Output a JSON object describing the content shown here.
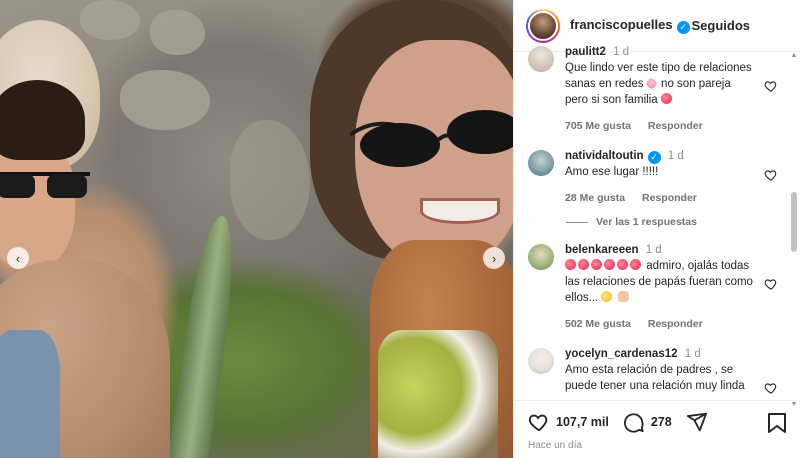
{
  "post": {
    "username": "franciscopuelles",
    "follow_state": "Seguidos"
  },
  "comments": [
    {
      "username": "paulitt2",
      "time": "1 d",
      "text": "Que lindo ver este tipo de relaciones sanas en redes",
      "text_tail": " no son pareja pero si son familia",
      "likes": "705 Me gusta",
      "reply": "Responder",
      "avatar_color": "#d9cfc6"
    },
    {
      "username": "natividaltoutin",
      "time": "1 d",
      "text": "Amo ese lugar !!!!!",
      "likes": "28 Me gusta",
      "reply": "Responder",
      "view_replies": "Ver las 1 respuestas",
      "avatar_color": "#7a9aa3"
    },
    {
      "username": "belenkareeen",
      "time": "1 d",
      "text": " admiro, ojalás todas las relaciones de papás fueran como ellos...",
      "likes": "502 Me gusta",
      "reply": "Responder",
      "avatar_color": "#9bb27c"
    },
    {
      "username": "yocelyn_cardenas12",
      "time": "1 d",
      "text": "Amo esta relación de padres , se puede tener una relación muy",
      "text_tail": "linda",
      "avatar_color": "#e6e1da"
    }
  ],
  "actions": {
    "likes": "107,7 mil",
    "comments": "278",
    "time_ago": "Hace un día"
  },
  "icons": {
    "like": "heart-icon",
    "comment": "comment-icon",
    "share": "share-icon",
    "save": "bookmark-icon",
    "verified": "verified-badge-icon"
  }
}
